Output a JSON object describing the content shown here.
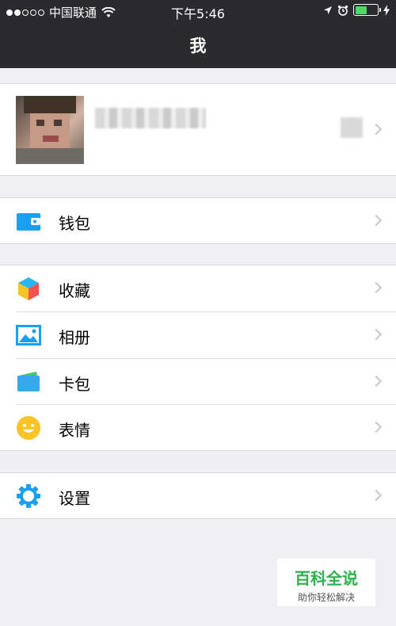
{
  "status_bar": {
    "carrier": "中国联通",
    "time": "下午5:46"
  },
  "header": {
    "title": "我"
  },
  "menu": {
    "wallet": "钱包",
    "favorites": "收藏",
    "album": "相册",
    "cards": "卡包",
    "stickers": "表情",
    "settings": "设置"
  },
  "watermark": {
    "title": "百科全说",
    "subtitle": "助你轻松解决"
  },
  "colors": {
    "header_bg": "#2b2b2f",
    "page_bg": "#efeff4",
    "accent_blue": "#1aa0f0",
    "battery_green": "#4cd964"
  }
}
